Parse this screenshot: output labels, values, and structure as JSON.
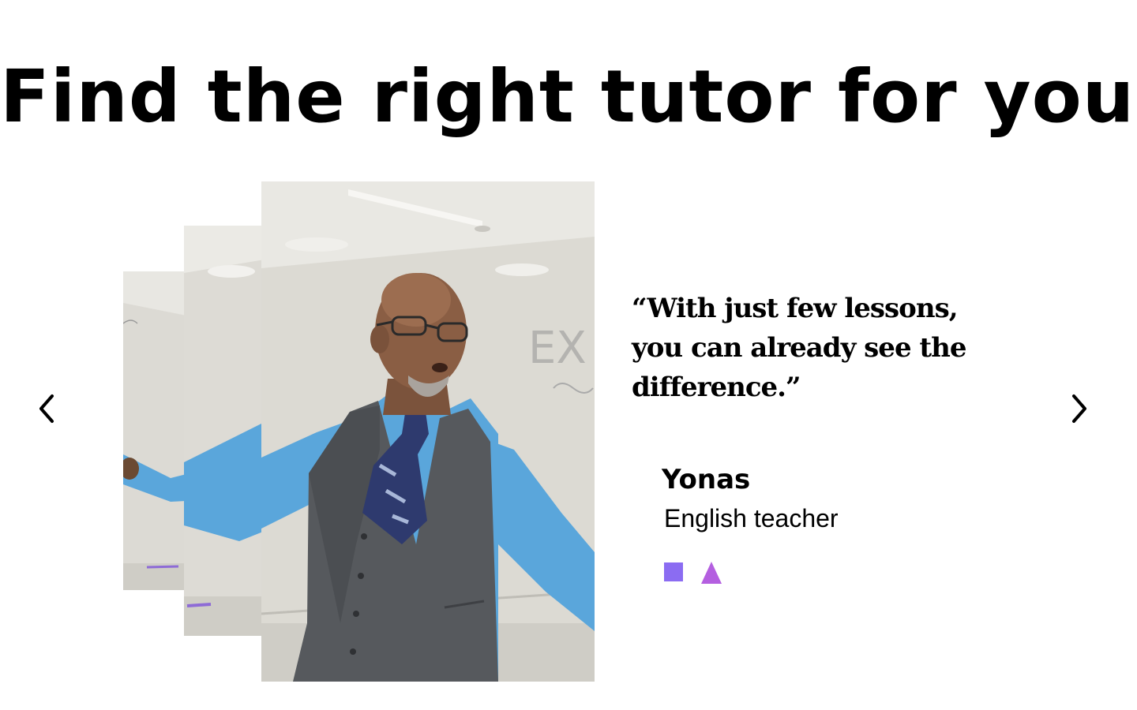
{
  "headline": "Find the right tutor for you.",
  "carousel": {
    "prev_icon": "chevron-left-icon",
    "next_icon": "chevron-right-icon"
  },
  "testimonial": {
    "quote": "“With just few lessons, you can already see the difference.”",
    "name": "Yonas",
    "role": "English teacher"
  },
  "colors": {
    "square": "#8b6cf2",
    "triangle": "#b45fe0",
    "shirt": "#5aa6db",
    "vest": "#55585c",
    "wall": "#dedcd6"
  }
}
